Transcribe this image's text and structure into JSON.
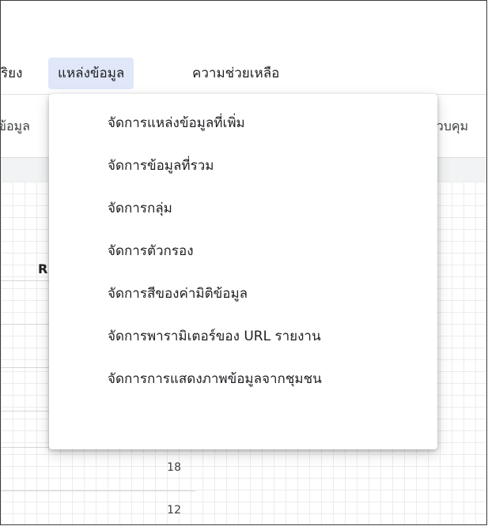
{
  "menubar": {
    "partial_item": "ริยง",
    "active_item": "แหล่งข้อมูล",
    "help_item": "ความช่วยเหลือ"
  },
  "toolbar": {
    "left_text": "ข้อมูล",
    "right_text": "ควบคุม"
  },
  "table": {
    "header_letter": "R",
    "values": [
      "18",
      "12"
    ]
  },
  "dropdown": {
    "items": [
      "จัดการแหล่งข้อมูลที่เพิ่ม",
      "จัดการข้อมูลที่รวม",
      "จัดการกลุ่ม",
      "จัดการตัวกรอง",
      "จัดการสีของค่ามิติข้อมูล",
      "จัดการพารามิเตอร์ของ URL รายงาน",
      "จัดการการแสดงภาพข้อมูลจากชุมชน"
    ]
  },
  "colors": {
    "active_menu_bg": "#dfe7f8",
    "text": "#202124"
  }
}
